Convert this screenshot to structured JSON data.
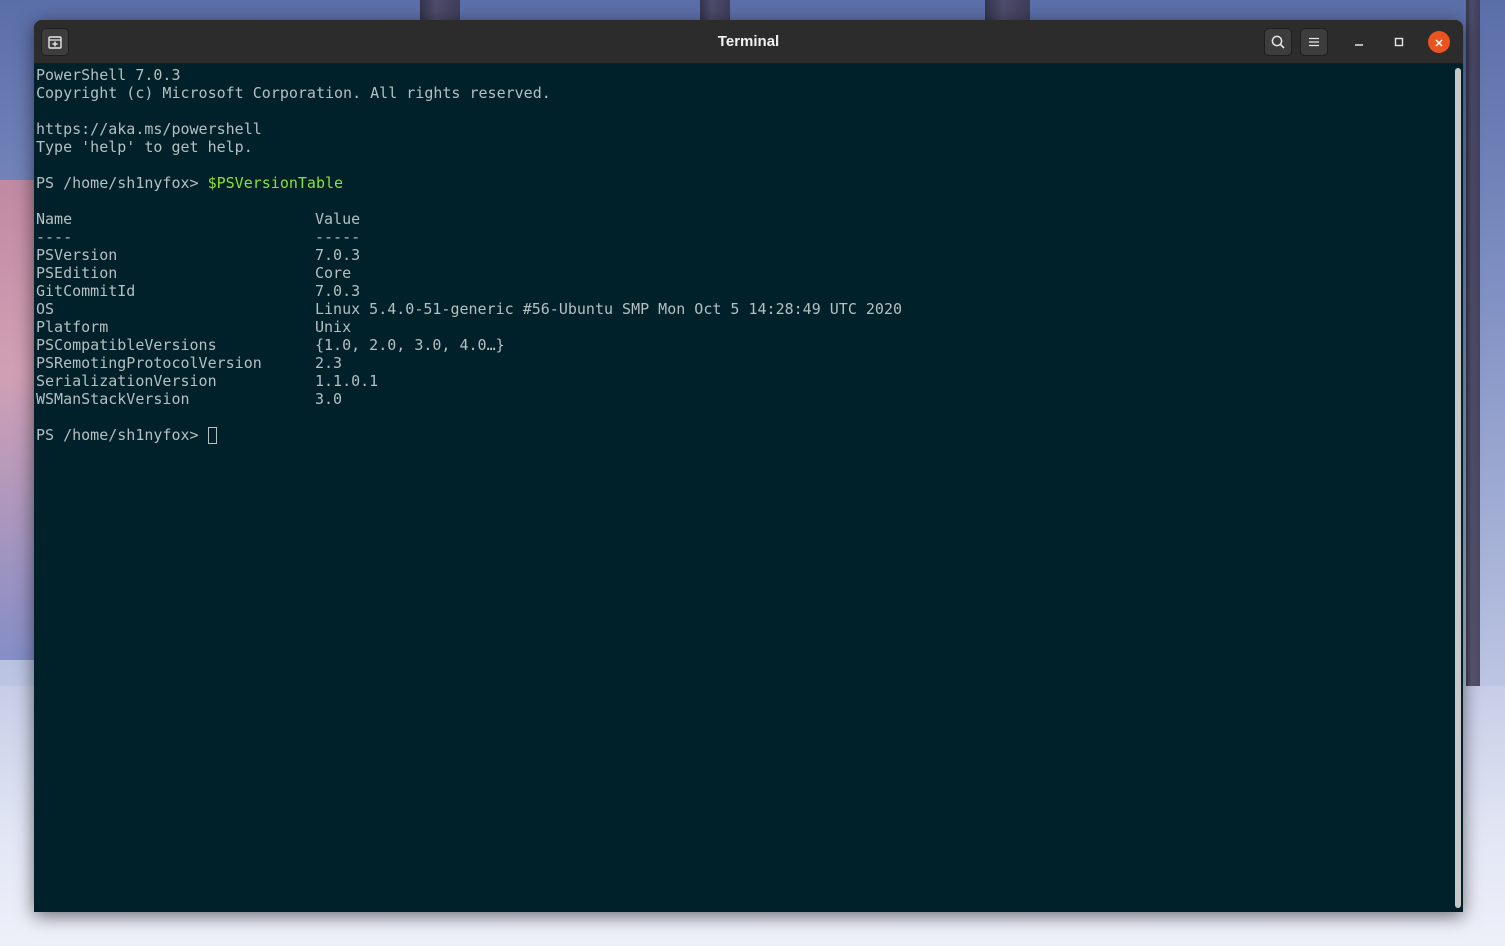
{
  "window": {
    "title": "Terminal"
  },
  "icons": {
    "new_tab": "new-tab-icon",
    "search": "search-icon",
    "menu": "hamburger-menu-icon",
    "minimize": "minimize-icon",
    "maximize": "maximize-icon",
    "close": "close-icon"
  },
  "colors": {
    "terminal_bg": "#002129",
    "terminal_fg": "#b6bfc3",
    "command_fg": "#8ae234",
    "close_button": "#e95420"
  },
  "terminal": {
    "banner": [
      "PowerShell 7.0.3",
      "Copyright (c) Microsoft Corporation. All rights reserved.",
      "",
      "https://aka.ms/powershell",
      "Type 'help' to get help."
    ],
    "prompt": "PS /home/sh1nyfox> ",
    "command": "$PSVersionTable",
    "table": {
      "headers": [
        "Name",
        "Value"
      ],
      "separators": [
        "----",
        "-----"
      ],
      "rows": [
        [
          "PSVersion",
          "7.0.3"
        ],
        [
          "PSEdition",
          "Core"
        ],
        [
          "GitCommitId",
          "7.0.3"
        ],
        [
          "OS",
          "Linux 5.4.0-51-generic #56-Ubuntu SMP Mon Oct 5 14:28:49 UTC 2020"
        ],
        [
          "Platform",
          "Unix"
        ],
        [
          "PSCompatibleVersions",
          "{1.0, 2.0, 3.0, 4.0…}"
        ],
        [
          "PSRemotingProtocolVersion",
          "2.3"
        ],
        [
          "SerializationVersion",
          "1.1.0.1"
        ],
        [
          "WSManStackVersion",
          "3.0"
        ]
      ]
    },
    "final_prompt": "PS /home/sh1nyfox> "
  }
}
